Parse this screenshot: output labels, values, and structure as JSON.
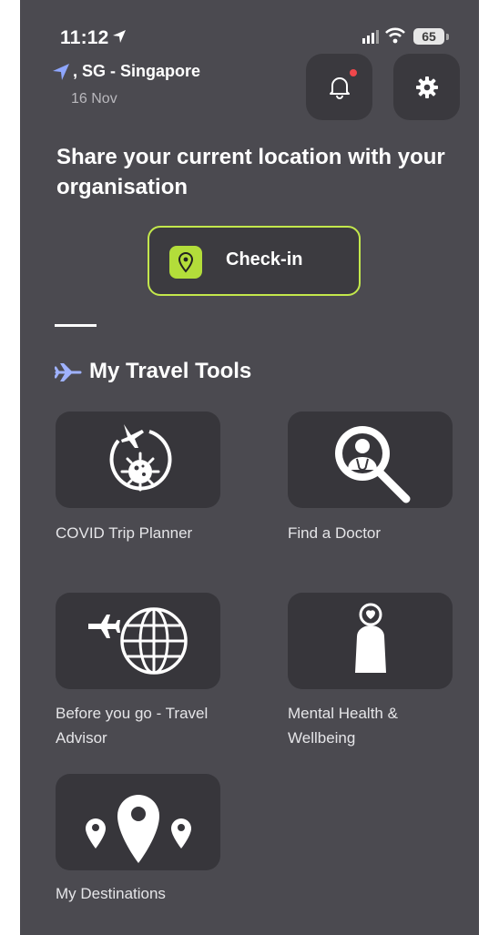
{
  "status_bar": {
    "time": "11:12",
    "battery": "65"
  },
  "location": {
    "text": ", SG - Singapore",
    "date": "16 Nov"
  },
  "share_prompt": "Share your current location with your organisation",
  "checkin_label": "Check-in",
  "tools_section": {
    "title": "My Travel Tools"
  },
  "tools": [
    {
      "label": "COVID Trip Planner",
      "icon": "covid-trip-icon"
    },
    {
      "label": "Find a Doctor",
      "icon": "doctor-search-icon"
    },
    {
      "label": "Before you go - Travel Advisor",
      "icon": "globe-plane-icon"
    },
    {
      "label": "Mental Health & Wellbeing",
      "icon": "wellbeing-person-icon"
    },
    {
      "label": "My Destinations",
      "icon": "location-pins-icon"
    }
  ],
  "colors": {
    "background": "#4b4a50",
    "tile": "#37363b",
    "accent": "#c3e84c",
    "notification_dot": "#f0474b",
    "location_arrow": "#8ea6ff"
  }
}
